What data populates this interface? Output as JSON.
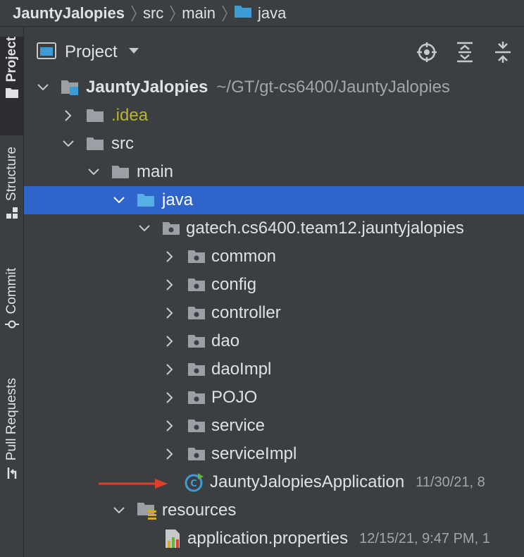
{
  "breadcrumb": {
    "items": [
      "JauntyJalopies",
      "src",
      "main",
      "java"
    ]
  },
  "stripe": {
    "tabs": [
      "Project",
      "Structure",
      "Commit",
      "Pull Requests"
    ]
  },
  "panel": {
    "title": "Project"
  },
  "tree": {
    "root_label": "JauntyJalopies",
    "root_path": "~/GT/gt-cs6400/JauntyJalopies",
    "idea": ".idea",
    "src": "src",
    "main": "main",
    "java": "java",
    "package": "gatech.cs6400.team12.jauntyjalopies",
    "subpackages": [
      "common",
      "config",
      "controller",
      "dao",
      "daoImpl",
      "POJO",
      "service",
      "serviceImpl"
    ],
    "app_class": "JauntyJalopiesApplication",
    "app_class_date": "11/30/21, 8",
    "resources": "resources",
    "properties": "application.properties",
    "properties_date": "12/15/21, 9:47 PM, 1"
  },
  "colors": {
    "panel_bg": "#3c3f41",
    "selection": "#2f65ca",
    "folder_blue": "#3d9bd5",
    "folder_gray": "#9aa0a6",
    "idea_text": "#bbb529",
    "annotation_arrow": "#e0402b"
  }
}
